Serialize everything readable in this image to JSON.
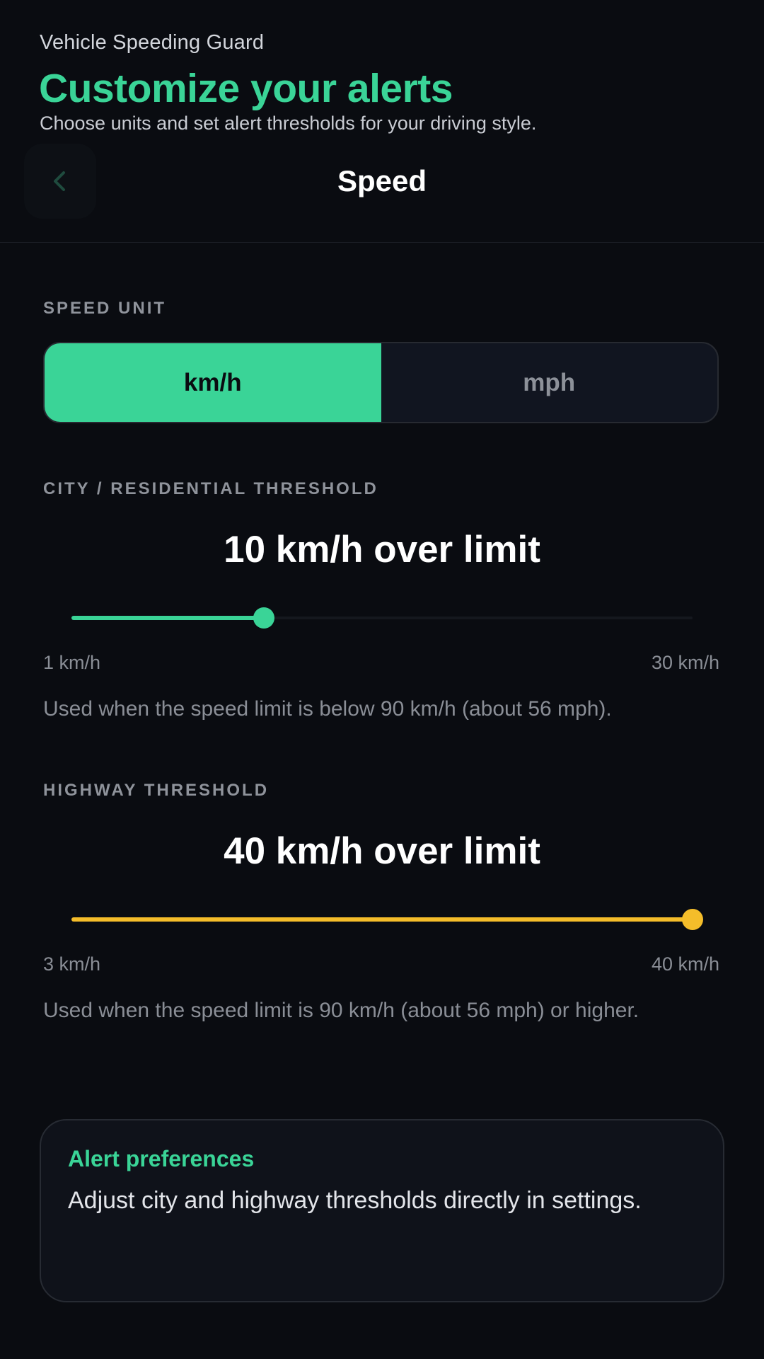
{
  "header": {
    "app_name": "Vehicle Speeding Guard",
    "headline": "Customize your alerts",
    "subhead": "Choose units and set alert thresholds for your driving style.",
    "screen_title": "Speed",
    "back_icon": "chevron-left-icon"
  },
  "speed_unit": {
    "label": "SPEED UNIT",
    "options": [
      "km/h",
      "mph"
    ],
    "selected": "km/h"
  },
  "city_threshold": {
    "label": "CITY / RESIDENTIAL THRESHOLD",
    "readout": "10 km/h over limit",
    "value": 10,
    "min": 1,
    "max": 30,
    "min_label": "1 km/h",
    "max_label": "30 km/h",
    "help": "Used when the speed limit is below 90 km/h (about 56 mph)."
  },
  "highway_threshold": {
    "label": "HIGHWAY THRESHOLD",
    "readout": "40 km/h over limit",
    "value": 40,
    "min": 3,
    "max": 40,
    "min_label": "3 km/h",
    "max_label": "40 km/h",
    "help": "Used when the speed limit is 90 km/h (about 56 mph) or higher."
  },
  "alert_preferences": {
    "title": "Alert preferences",
    "body": "Adjust city and highway thresholds directly in settings."
  },
  "colors": {
    "accent": "#3ad497",
    "highway_accent": "#f4bd2a",
    "background": "#0a0c11"
  }
}
